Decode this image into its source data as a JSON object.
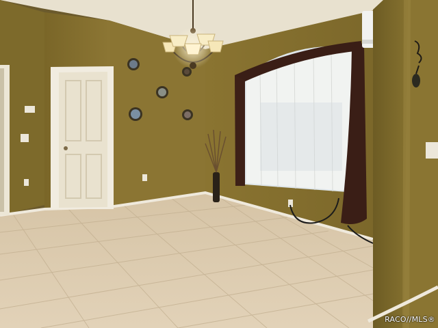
{
  "photo": {
    "watermark": "RACO//MLS®"
  },
  "palette": {
    "wall_olive": "#8a7532",
    "wall_shadow": "#6e5d26",
    "ceiling": "#e9e3d3",
    "floor_tile": "#d9c8ae",
    "grout": "#bfae92",
    "trim": "#f1ece0",
    "door": "#ece6d6",
    "curtain_brown": "#3a1e16",
    "sheer": "#f3f3f1",
    "window_light": "#dfe6ea"
  }
}
